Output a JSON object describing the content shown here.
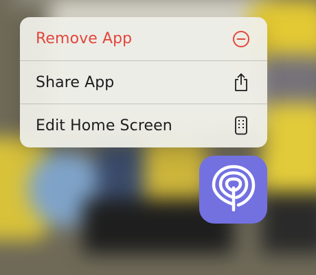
{
  "context_menu": {
    "items": [
      {
        "label": "Remove App",
        "icon": "minus-circle-icon",
        "destructive": true
      },
      {
        "label": "Share App",
        "icon": "share-icon",
        "destructive": false
      },
      {
        "label": "Edit Home Screen",
        "icon": "phone-icon",
        "destructive": false
      }
    ]
  },
  "app_icon": {
    "icon": "life360-logo-icon",
    "background_color": "#7371e0"
  },
  "colors": {
    "destructive": "#e2463b",
    "label": "#1c1c1e"
  }
}
